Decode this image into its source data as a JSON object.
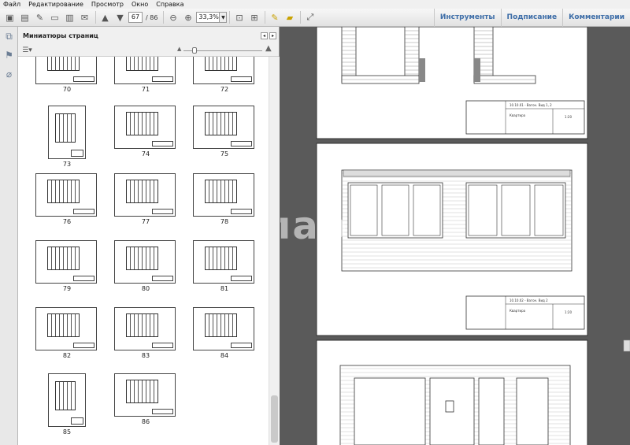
{
  "menu": [
    "Файл",
    "Редактирование",
    "Просмотр",
    "Окно",
    "Справка"
  ],
  "toolbar": {
    "current_page": "67",
    "total_pages": "/ 86",
    "zoom": "33,3%"
  },
  "right_links": [
    "Инструменты",
    "Подписание",
    "Комментарии"
  ],
  "panel": {
    "title": "Миниатюры страниц"
  },
  "thumbnails": [
    "70",
    "71",
    "72",
    "73",
    "74",
    "75",
    "76",
    "77",
    "78",
    "79",
    "80",
    "81",
    "82",
    "83",
    "84",
    "85",
    "86"
  ],
  "sheets": {
    "top": {
      "title_code": "10.10.01 - Вагон. Вид 1, 2",
      "scale": "1:20",
      "name": "Квартира"
    },
    "middle": {
      "title_code": "10.10.02 - Вагон. Вид 2",
      "scale": "1:20",
      "name": "Квартира"
    },
    "bottom": {}
  },
  "watermark": "ппар"
}
